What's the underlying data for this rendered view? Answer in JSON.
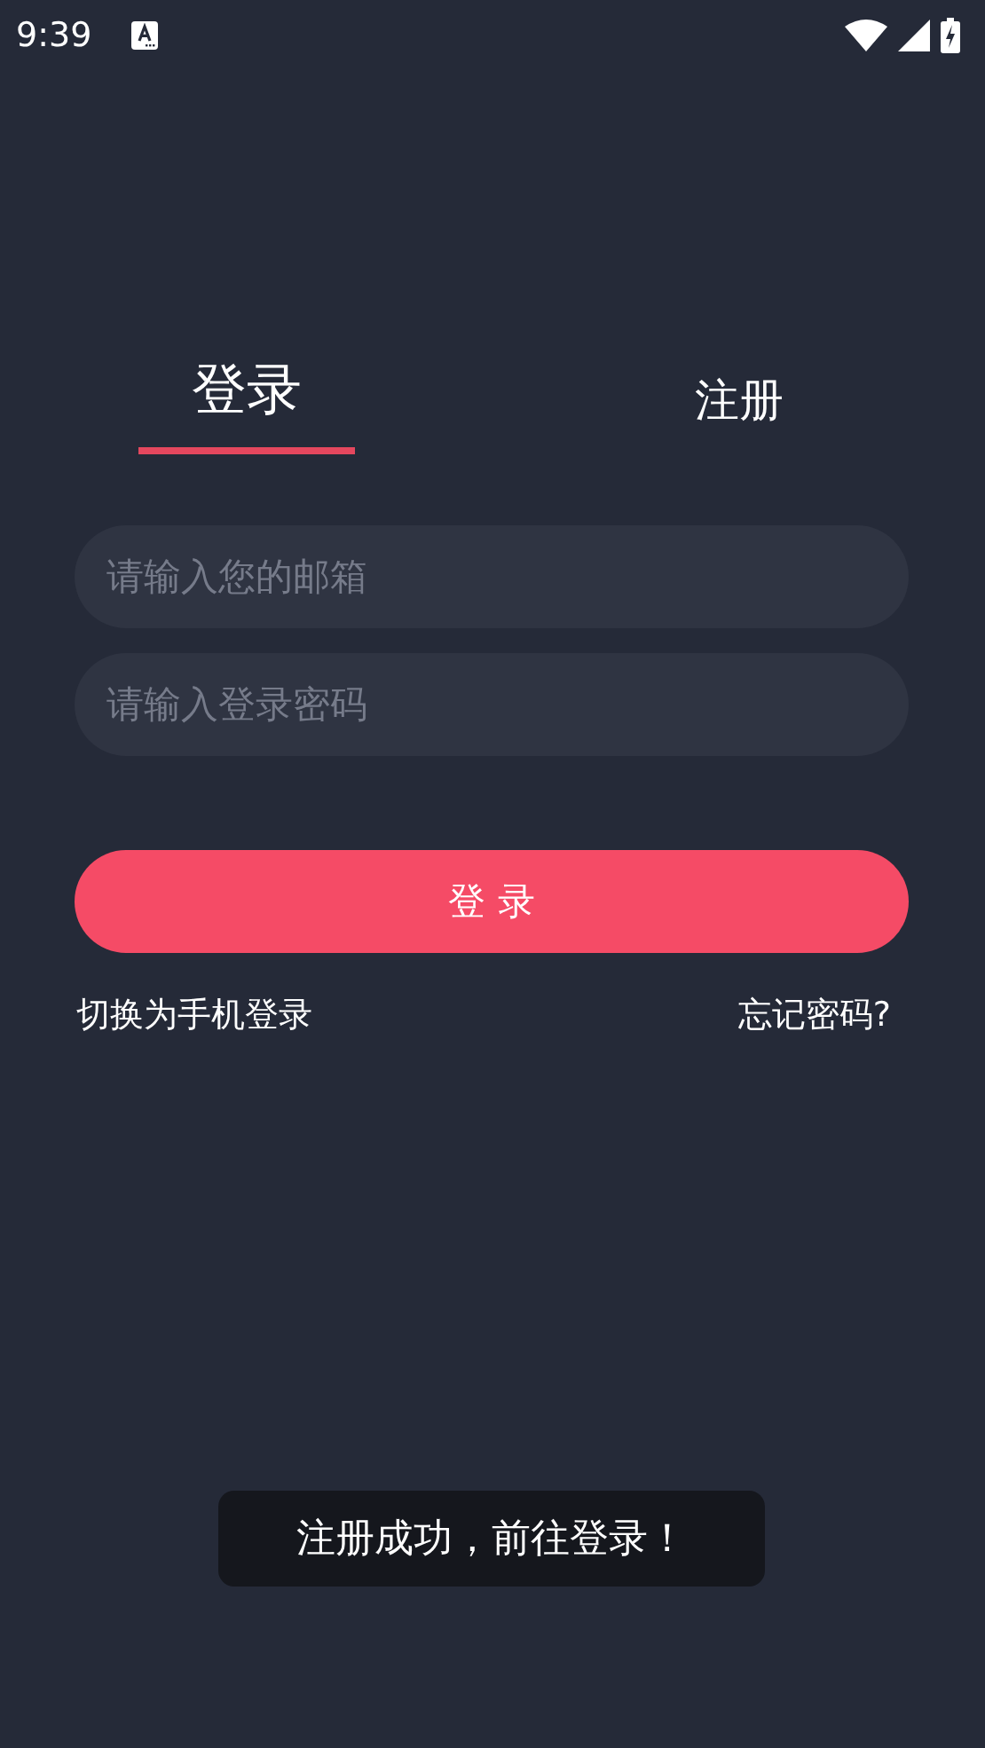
{
  "status_bar": {
    "time": "9:39"
  },
  "tabs": [
    {
      "label": "登录",
      "selected": true
    },
    {
      "label": "注册",
      "selected": false
    }
  ],
  "fields": [
    {
      "placeholder": "请输入您的邮箱"
    },
    {
      "placeholder": "请输入登录密码"
    }
  ],
  "login_button": "登 录",
  "links": {
    "switch": "切换为手机登录",
    "forgot": "忘记密码?"
  },
  "toast": "注册成功，前往登录！"
}
